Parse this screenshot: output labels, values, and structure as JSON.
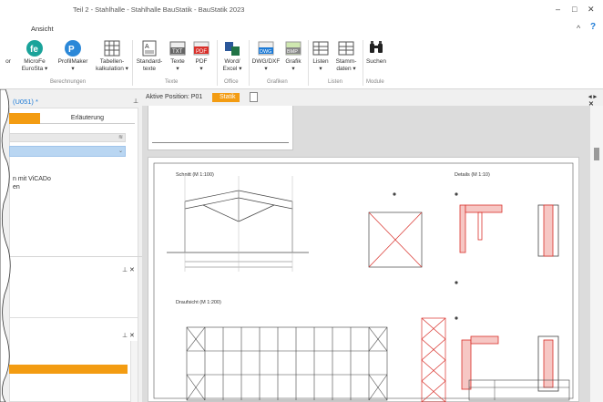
{
  "window": {
    "title": "Teil 2 - Stahlhalle - Stahlhalle BauStatik - BauStatik 2023",
    "controls": [
      "–",
      "□",
      "✕"
    ]
  },
  "menu": {
    "tab": "Ansicht",
    "right_icons": [
      "^",
      "?"
    ]
  },
  "ribbon": {
    "groups": [
      {
        "label": "Berechnungen",
        "items": [
          {
            "label": "or",
            "icon": "partial-icon"
          },
          {
            "label": "MicroFe\nEuroSta ▾",
            "icon": "microfe-icon",
            "color": "#1aa39a"
          },
          {
            "label": "ProfilMaker\n▾",
            "icon": "profilmaker-icon",
            "color": "#2b88d8"
          },
          {
            "label": "Tabellen-\nkalkulation ▾",
            "icon": "table-icon"
          }
        ]
      },
      {
        "label": "Texte",
        "items": [
          {
            "label": "Standard-\ntexte",
            "icon": "standard-text-icon"
          },
          {
            "label": "Texte\n▾",
            "icon": "txt-icon"
          },
          {
            "label": "PDF\n▾",
            "icon": "pdf-icon",
            "color": "#d9302a"
          }
        ]
      },
      {
        "label": "Office",
        "items": [
          {
            "label": "Word/\nExcel ▾",
            "icon": "word-excel-icon"
          }
        ]
      },
      {
        "label": "Grafiken",
        "items": [
          {
            "label": "DWG/DXF\n▾",
            "icon": "dwg-icon"
          },
          {
            "label": "Grafik\n▾",
            "icon": "bmp-icon"
          }
        ]
      },
      {
        "label": "Listen",
        "items": [
          {
            "label": "Listen\n▾",
            "icon": "list-icon"
          },
          {
            "label": "Stamm-\ndaten ▾",
            "icon": "master-data-icon"
          }
        ]
      },
      {
        "label": "Module",
        "items": [
          {
            "label": "Suchen",
            "icon": "binoculars-icon"
          }
        ]
      }
    ]
  },
  "left_panel": {
    "title": "(U051) *",
    "tab_active": "",
    "tab_other": "Erläuterung",
    "text_line1": "n mit ViCADo",
    "text_line2": "en"
  },
  "doc_tabs": {
    "position": "Aktive Position: P01",
    "active": "Statik",
    "nav": "◂ ▸ ✕"
  },
  "drawing": {
    "schnitt": "Schnitt (M 1:100)",
    "details": "Details (M 1:10)",
    "draufsicht": "Draufsicht (M 1:200)"
  },
  "colors": {
    "accent_orange": "#f39c12",
    "accent_blue": "#1c7ad6",
    "steel_red": "#d9302a"
  }
}
